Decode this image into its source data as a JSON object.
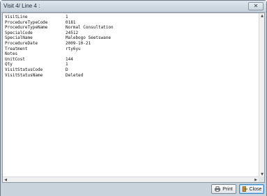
{
  "window": {
    "title": "Visit 4/ Line 4 :",
    "close_glyph": "✕"
  },
  "record": [
    {
      "key": "VisitLine",
      "value": "1"
    },
    {
      "key": "ProcedureTypeCode",
      "value": "0181"
    },
    {
      "key": "ProcedureTypeName",
      "value": "Normal Consultation"
    },
    {
      "key": "SpecialCode",
      "value": "24512"
    },
    {
      "key": "SpecialName",
      "value": "Malebogo Seetswane"
    },
    {
      "key": "ProcedureDate",
      "value": "2009-10-21"
    },
    {
      "key": "Treatment",
      "value": "rty6yu"
    },
    {
      "key": "Notes",
      "value": ""
    },
    {
      "key": "UnitCost",
      "value": "144"
    },
    {
      "key": "Qty",
      "value": "1"
    },
    {
      "key": "VisitStatusCode",
      "value": "D"
    },
    {
      "key": "VisitStatusName",
      "value": "Deleted"
    }
  ],
  "buttons": {
    "print_label": "Print",
    "close_label": "Close"
  },
  "icons": {
    "print": "printer-icon",
    "close": "door-exit-icon"
  }
}
